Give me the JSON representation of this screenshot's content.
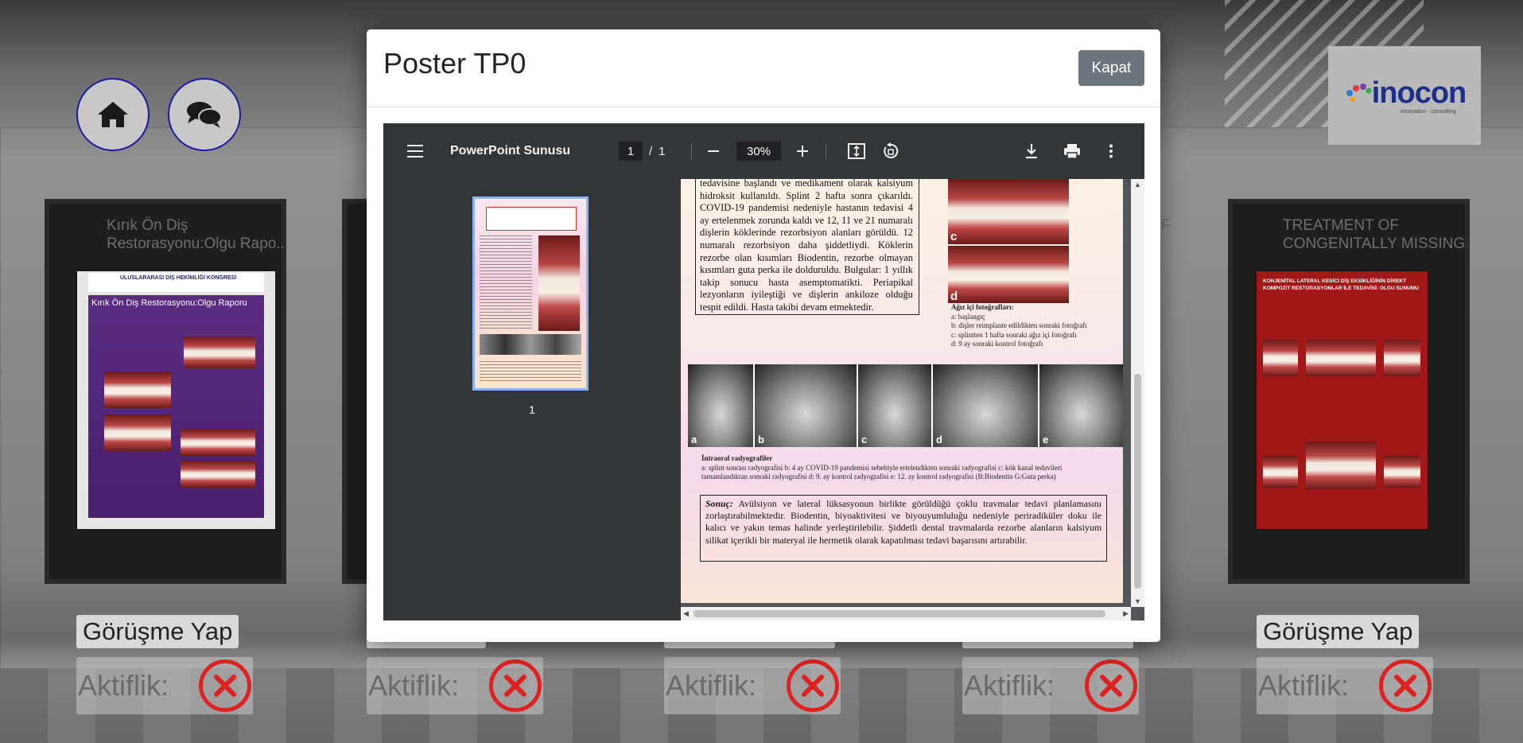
{
  "background": {
    "nav": {
      "home_icon": "home-icon",
      "chat_icon": "chat-bubbles-icon"
    },
    "logo": {
      "text": "inocon",
      "sub": "innovation - consulting"
    },
    "posters": [
      {
        "title": "Kırık Ön Diş Restorasyonu:Olgu Rapo...",
        "talk_label": "Görüşme Yap",
        "active_label": "Aktiflik:",
        "poster_header": "ULUSLARARASI DİŞ HEKİMLİĞİ KONGRESİ",
        "poster_title": "Kırık Ön Diş Restorasyonu:Olgu Raporu"
      },
      {
        "title": "",
        "talk_label": "",
        "active_label": "Aktiflik:"
      },
      {
        "title": "",
        "talk_label": "",
        "active_label": "Aktiflik:"
      },
      {
        "title": "F",
        "talk_label": "",
        "active_label": "Aktiflik:"
      },
      {
        "title": "TREATMENT OF CONGENITALLY MISSING L",
        "talk_label": "Görüşme Yap",
        "active_label": "Aktiflik:",
        "poster_title": "KONJENİTAL LATERAL KESİCİ DİŞ EKSİKLİĞİNİN DİREKT KOMPOZİT RESTORASYONLAR İLE TEDAVİSİ: OLGU SUNUMU"
      }
    ]
  },
  "modal": {
    "title": "Poster TP0",
    "close_label": "Kapat"
  },
  "viewer": {
    "doc_name": "PowerPoint Sunusu",
    "page_current": "1",
    "page_sep": "/",
    "page_total": "1",
    "zoom": "30%",
    "thumb_label": "1",
    "icons": {
      "menu": "menu-icon",
      "zoom_out": "minus-icon",
      "zoom_in": "plus-icon",
      "fit": "fit-page-icon",
      "rotate": "rotate-icon",
      "download": "download-icon",
      "print": "print-icon",
      "more": "more-vert-icon"
    }
  },
  "poster_page": {
    "case_text": "tedavisine başlandı ve medikament olarak kalsiyum hidroksit kullanıldı. Splint 2 hafta sonra çıkarıldı. COVID-19 pandemisi nedeniyle hastanın tedavisi 4 ay ertelenmek zorunda kaldı ve 12, 11 ve 21 numaralı dişlerin köklerinde rezorbsiyon alanları görüldü. 12 numaralı rezorbsiyon daha şiddetliydi. Köklerin rezorbe olan kısımları Biodentin, rezorbe olmayan kısımları guta perka ile dolduruldu. Bulgular: 1 yıllık takip sonucu hasta asemptomatikti. Periapikal lezyonların iyileştiği ve dişlerin ankiloze olduğu tespit edildi. Hasta takibi devam etmektedir.",
    "photo_labels": [
      "c",
      "d"
    ],
    "photo_caption_title": "Ağız içi fotoğrafları:",
    "photo_caption_lines": [
      "a: başlangıç",
      "b: dişler reimplante edildikten sonraki fotoğrafı",
      "c: splintten 1 hafta sonraki ağız içi fotoğrafı",
      "d: 9 ay sonraki kontrol fotoğrafı"
    ],
    "xray_labels": [
      "a",
      "b",
      "c",
      "d",
      "e"
    ],
    "xray_caption_title": "İntraoral radyografiler",
    "xray_caption_text": "a: splint sonrası radyografisi b: 4 ay COVID-19 pandemisi sebebiyle ertelendikten sonraki radyografisi c: kök kanal tedavileri tamamlandıktan sonraki radyografisi d: 9. ay kontrol radyografisi e: 12. ay kontrol radyografisi (B:Biodentin G:Guta perka)",
    "conclusion_title": "Sonuç:",
    "conclusion_text": "Avülsiyon ve lateral lüksasyonun birlikte görüldüğü çoklu travmalar tedavi planlamasını zorlaştırabilmektedir. Biodentin, biyoaktivitesi ve biyouyumluluğu nedeniyle periradiküler doku ile kalıcı ve yakın temas halinde yerleştirilebilir. Şiddetli dental travmalarda rezorbe alanların kalsiyum silikat içerikli bir materyal ile hermetik olarak kapatılması tedavi başarısını artırabilir."
  }
}
